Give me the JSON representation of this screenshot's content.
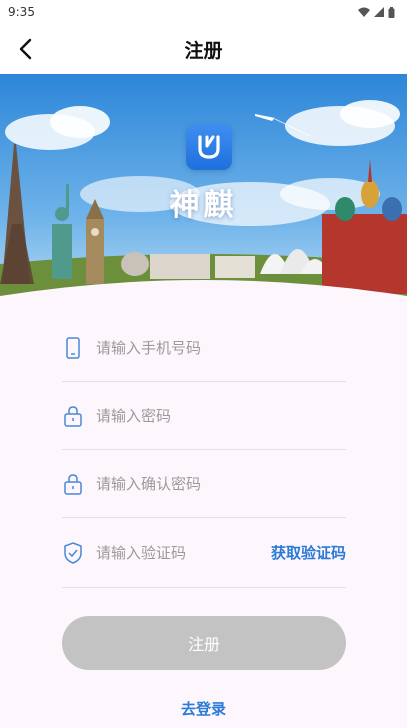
{
  "status_bar": {
    "time": "9:35"
  },
  "header": {
    "title": "注册"
  },
  "brand": {
    "app_name": "神麒"
  },
  "form": {
    "phone_placeholder": "请输入手机号码",
    "password_placeholder": "请输入密码",
    "confirm_placeholder": "请输入确认密码",
    "code_placeholder": "请输入验证码",
    "get_code_label": "获取验证码"
  },
  "actions": {
    "register_label": "注册",
    "login_link": "去登录"
  },
  "colors": {
    "accent": "#2a7ad8",
    "disabled_button": "#c3c3c3",
    "background": "#fdf7fd"
  }
}
